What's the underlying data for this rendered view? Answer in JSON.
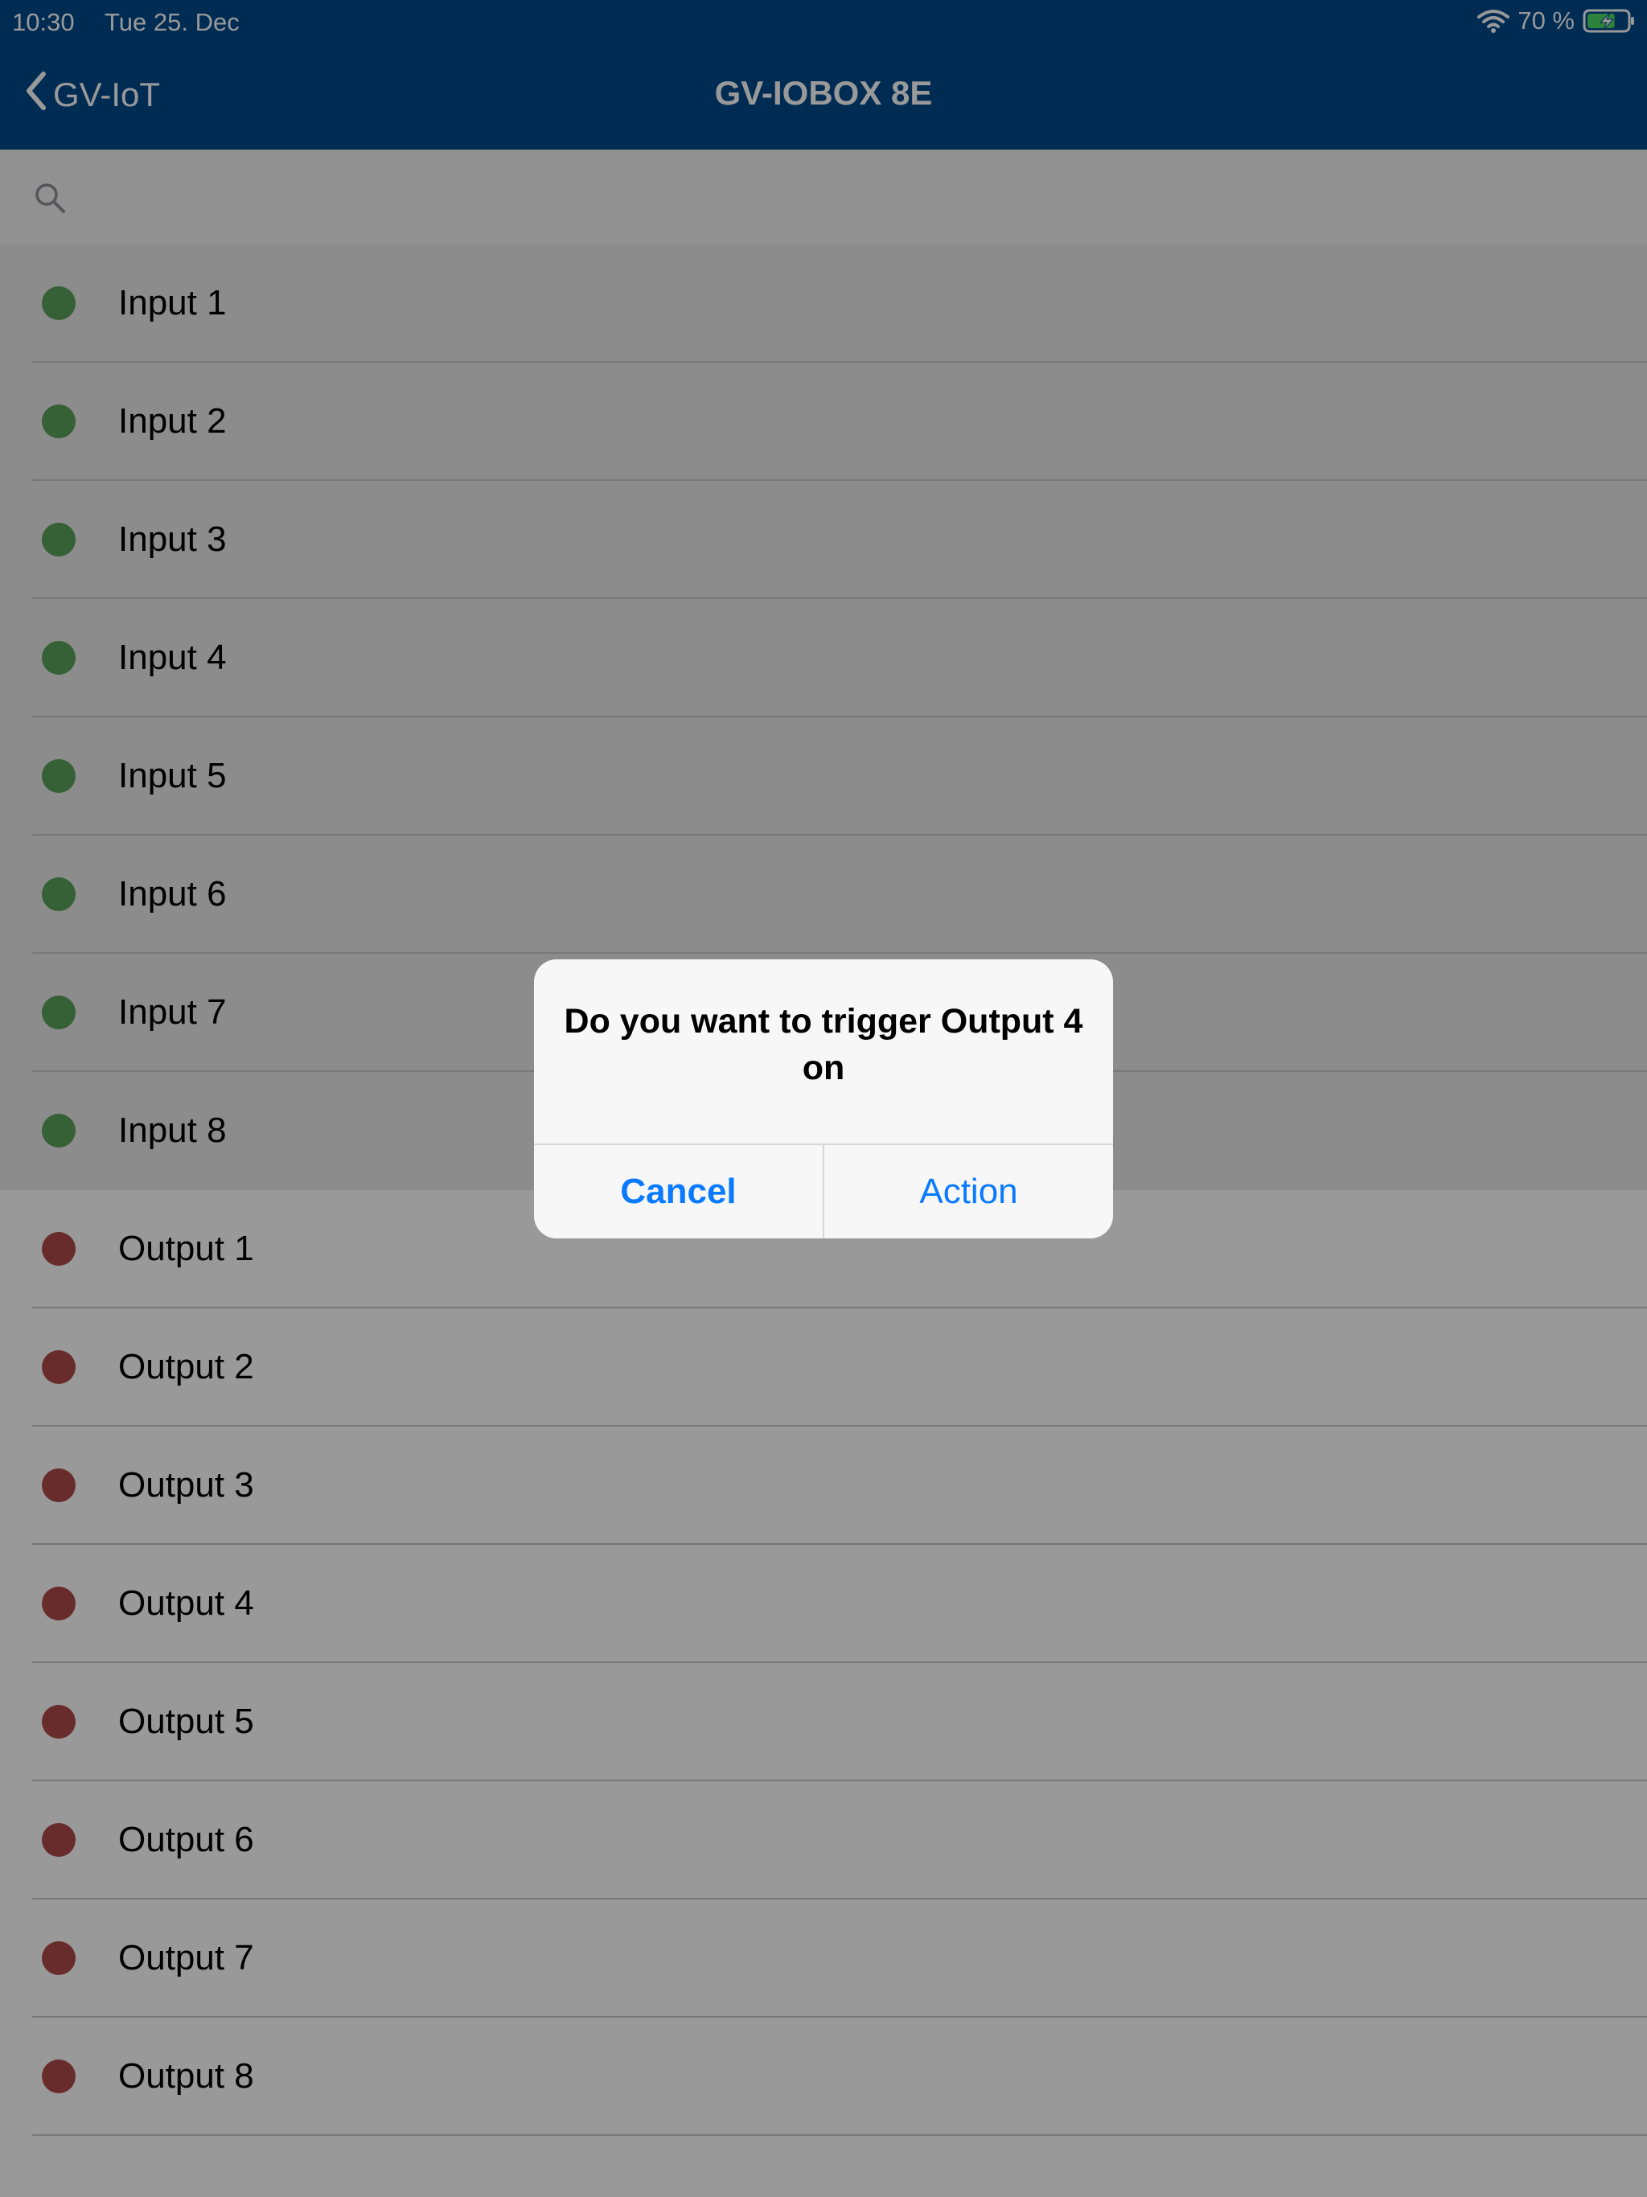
{
  "status_bar": {
    "time": "10:30",
    "date": "Tue 25. Dec",
    "battery_percent": "70 %",
    "battery_level": 0.7,
    "charging": true
  },
  "nav": {
    "back_label": "GV-IoT",
    "title": "GV-IOBOX 8E"
  },
  "search": {
    "placeholder": "",
    "value": ""
  },
  "colors": {
    "header_bg": "#004a8c",
    "input_dot": "#5aa05a",
    "output_dot": "#b04a4a",
    "link_blue": "#0a7aff"
  },
  "list": {
    "inputs": [
      "Input 1",
      "Input 2",
      "Input 3",
      "Input 4",
      "Input 5",
      "Input 6",
      "Input 7",
      "Input 8"
    ],
    "outputs": [
      "Output 1",
      "Output 2",
      "Output 3",
      "Output 4",
      "Output 5",
      "Output 6",
      "Output 7",
      "Output 8"
    ]
  },
  "alert": {
    "message": "Do you want to trigger Output 4 on",
    "cancel_label": "Cancel",
    "action_label": "Action"
  }
}
